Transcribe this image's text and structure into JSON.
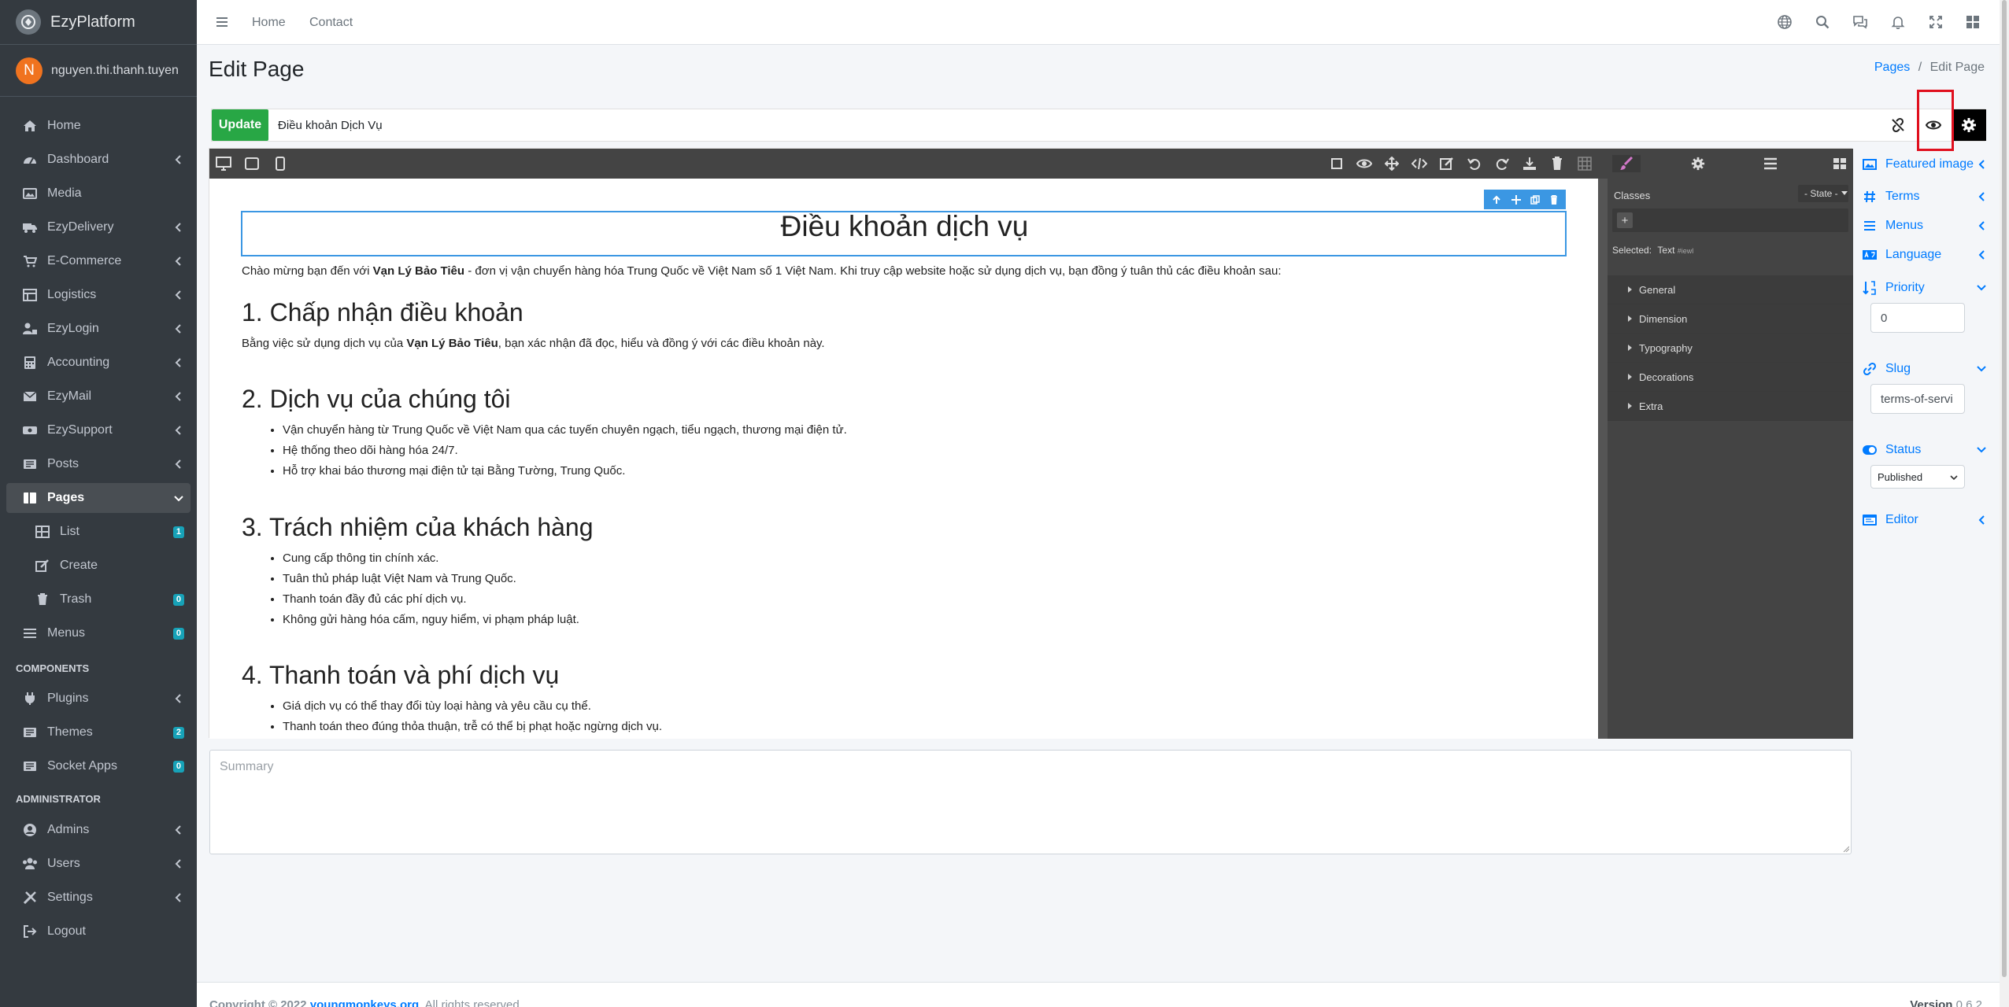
{
  "app": {
    "brand": "EzyPlatform",
    "user_initial": "N",
    "user_name": "nguyen.thi.thanh.tuyen"
  },
  "sidebar": {
    "items": [
      {
        "label": "Home",
        "icon": "home-icon"
      },
      {
        "label": "Dashboard",
        "icon": "dashboard-icon"
      },
      {
        "label": "Media",
        "icon": "media-icon"
      },
      {
        "label": "EzyDelivery",
        "icon": "truck-icon"
      },
      {
        "label": "E-Commerce",
        "icon": "cart-icon"
      },
      {
        "label": "Logistics",
        "icon": "logistics-icon"
      },
      {
        "label": "EzyLogin",
        "icon": "user-lock-icon"
      },
      {
        "label": "Accounting",
        "icon": "calculator-icon"
      },
      {
        "label": "EzyMail",
        "icon": "mail-icon"
      },
      {
        "label": "EzySupport",
        "icon": "support-icon"
      },
      {
        "label": "Posts",
        "icon": "posts-icon"
      },
      {
        "label": "Pages",
        "icon": "pages-icon"
      },
      {
        "label": "List",
        "icon": "list-icon",
        "badge": "1"
      },
      {
        "label": "Create",
        "icon": "edit-icon"
      },
      {
        "label": "Trash",
        "icon": "trash-icon",
        "badge": "0"
      },
      {
        "label": "Menus",
        "icon": "menu-icon",
        "badge": "0"
      },
      {
        "label": "Plugins",
        "icon": "plug-icon"
      },
      {
        "label": "Themes",
        "icon": "themes-icon",
        "badge": "2"
      },
      {
        "label": "Socket Apps",
        "icon": "socket-icon",
        "badge": "0"
      },
      {
        "label": "Admins",
        "icon": "admin-icon"
      },
      {
        "label": "Users",
        "icon": "users-icon"
      },
      {
        "label": "Settings",
        "icon": "tools-icon"
      },
      {
        "label": "Logout",
        "icon": "logout-icon"
      }
    ],
    "headers": [
      "COMPONENTS",
      "ADMINISTRATOR"
    ]
  },
  "navbar": {
    "home": "Home",
    "contact": "Contact"
  },
  "header": {
    "title": "Edit Page",
    "breadcrumb_link": "Pages",
    "breadcrumb_sep": "/",
    "breadcrumb_current": "Edit Page"
  },
  "titlebar": {
    "update_label": "Update",
    "title_value": "Điều khoản Dịch Vụ"
  },
  "document": {
    "title": "Điều khoản dịch vụ",
    "intro_pre": "Chào mừng bạn đến với ",
    "intro_bold": "Vạn Lý Bảo Tiêu",
    "intro_post": " - đơn vị vận chuyển hàng hóa Trung Quốc về Việt Nam số 1 Việt Nam. Khi truy cập website hoặc sử dụng dịch vụ, bạn đồng ý tuân thủ các điều khoản sau:",
    "s1_title": "1. Chấp nhận điều khoản",
    "s1_pre": "Bằng việc sử dụng dịch vụ của ",
    "s1_bold": "Vạn Lý Bảo Tiêu",
    "s1_post": ", bạn xác nhận đã đọc, hiểu và đồng ý với các điều khoản này.",
    "s2_title": "2. Dịch vụ của chúng tôi",
    "s2_items": [
      "Vận chuyển hàng từ Trung Quốc về Việt Nam qua các tuyến chuyên ngạch, tiểu ngạch, thương mại điện tử.",
      "Hệ thống theo dõi hàng hóa 24/7.",
      "Hỗ trợ khai báo thương mại điện tử tại Bằng Tường, Trung Quốc."
    ],
    "s3_title": "3. Trách nhiệm của khách hàng",
    "s3_items": [
      "Cung cấp thông tin chính xác.",
      "Tuân thủ pháp luật Việt Nam và Trung Quốc.",
      "Thanh toán đầy đủ các phí dịch vụ.",
      "Không gửi hàng hóa cấm, nguy hiểm, vi phạm pháp luật."
    ],
    "s4_title": "4. Thanh toán và phí dịch vụ",
    "s4_items": [
      "Giá dịch vụ có thể thay đổi tùy loại hàng và yêu cầu cụ thể.",
      "Thanh toán theo đúng thỏa thuận, trễ có thể bị phạt hoặc ngừng dịch vụ."
    ]
  },
  "style_panel": {
    "classes_label": "Classes",
    "state_label": "- State -",
    "add_label": "+",
    "selected_label": "Selected:",
    "selected_value": "Text",
    "selected_id": "#iewl",
    "sections": [
      "General",
      "Dimension",
      "Typography",
      "Decorations",
      "Extra"
    ]
  },
  "summary": {
    "placeholder": "Summary"
  },
  "meta": {
    "featured_image": "Featured image",
    "terms": "Terms",
    "menus": "Menus",
    "language": "Language",
    "priority": "Priority",
    "priority_value": "0",
    "slug": "Slug",
    "slug_value": "terms-of-servi",
    "status": "Status",
    "status_value": "Published",
    "editor": "Editor"
  },
  "footer": {
    "copyright": "Copyright © 2022 ",
    "link": "youngmonkeys.org",
    "rights": ". All rights reserved.",
    "version_label": "Version",
    "version_value": "0.6.2"
  },
  "colors": {
    "sidebar_bg": "#343a40",
    "accent": "#007bff",
    "update_green": "#28a745",
    "badge": "#17a2b8",
    "highlight": "#e0101e"
  }
}
